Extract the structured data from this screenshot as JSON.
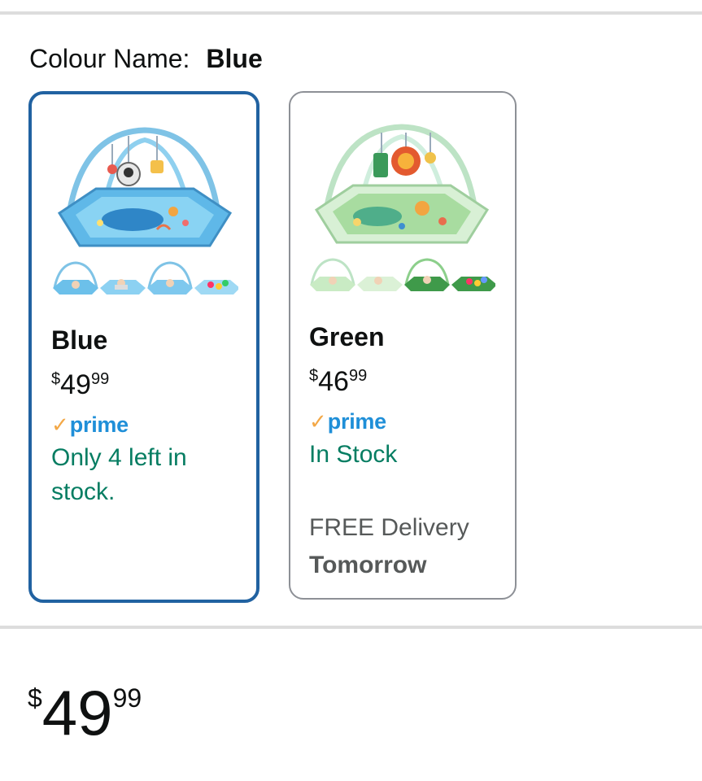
{
  "colour_selector": {
    "label": "Colour Name:",
    "selected_value": "Blue"
  },
  "swatches": [
    {
      "name": "Blue",
      "price_symbol": "$",
      "price_whole": "49",
      "price_fraction": "99",
      "prime_check": "✓",
      "prime_label": "prime",
      "availability": "Only 4 left in stock.",
      "selected": true,
      "image_theme": "blue",
      "thumbnail_count": 4
    },
    {
      "name": "Green",
      "price_symbol": "$",
      "price_whole": "46",
      "price_fraction": "99",
      "prime_check": "✓",
      "prime_label": "prime",
      "availability": "In Stock",
      "delivery_text": "FREE Delivery",
      "delivery_day": "Tomorrow",
      "selected": false,
      "image_theme": "green",
      "thumbnail_count": 4
    }
  ],
  "price": {
    "symbol": "$",
    "whole": "49",
    "fraction": "99"
  },
  "colors": {
    "selected_border": "#2162a1",
    "unselected_border": "#8d9096",
    "availability": "#067d62",
    "prime_blue": "#1f8fd8",
    "prime_check": "#f3a847",
    "delivery_text": "#565959",
    "divider": "#dddddd"
  },
  "icons": {
    "prime_check": "prime-check-icon"
  }
}
